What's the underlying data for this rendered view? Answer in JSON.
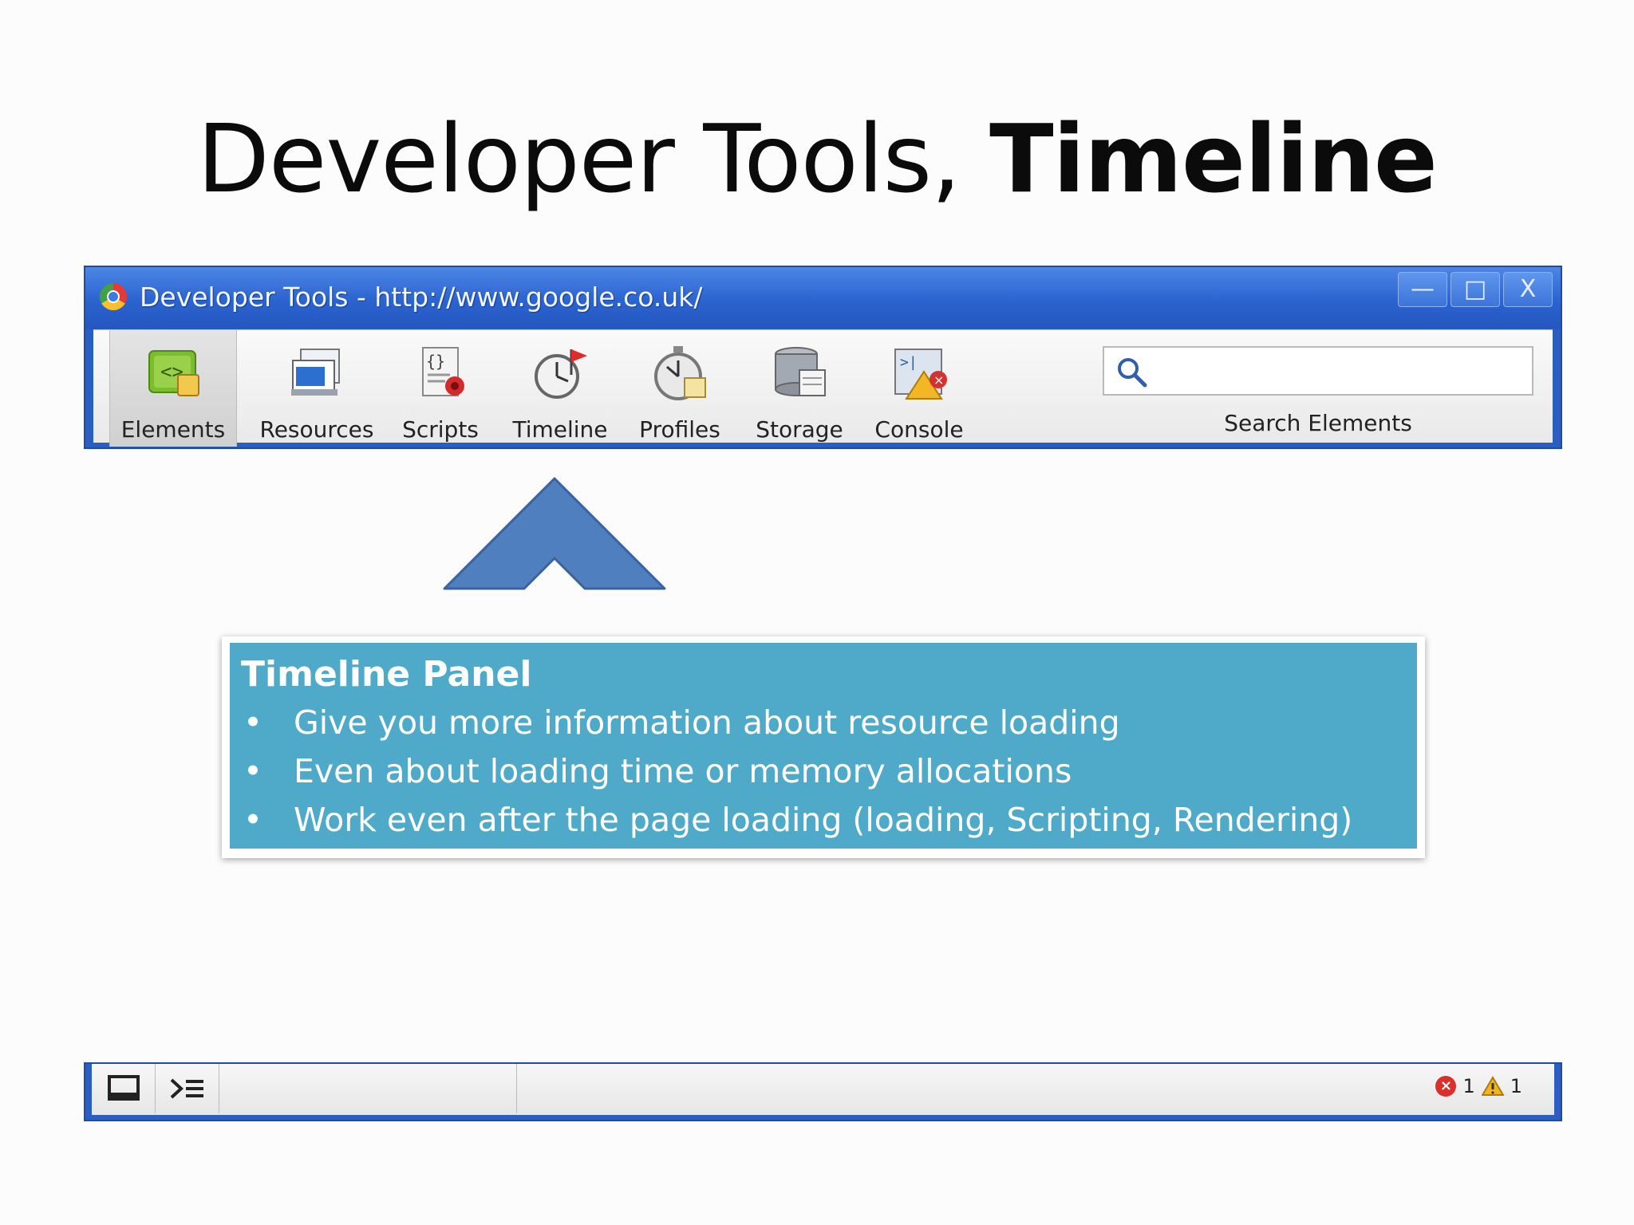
{
  "slide": {
    "title_regular": "Developer Tools, ",
    "title_bold": "Timeline"
  },
  "window": {
    "title": "Developer Tools - http://www.google.co.uk/",
    "controls": {
      "minimize": "—",
      "maximize": "□",
      "close": "X"
    }
  },
  "toolbar": {
    "items": [
      {
        "label": "Elements",
        "icon": "elements-icon"
      },
      {
        "label": "Resources",
        "icon": "resources-icon"
      },
      {
        "label": "Scripts",
        "icon": "scripts-icon"
      },
      {
        "label": "Timeline",
        "icon": "timeline-icon"
      },
      {
        "label": "Profiles",
        "icon": "profiles-icon"
      },
      {
        "label": "Storage",
        "icon": "storage-icon"
      },
      {
        "label": "Console",
        "icon": "console-icon"
      }
    ],
    "selected": "Elements",
    "search": {
      "value": "",
      "label": "Search Elements"
    }
  },
  "callout": {
    "title": "Timeline Panel",
    "bullet": "•",
    "items": [
      "Give you more information about resource loading",
      "Even about loading time or memory allocations",
      "Work even after the page loading (loading, Scripting, Rendering)"
    ],
    "color": "#4eaac8"
  },
  "statusbar": {
    "error_count": "1",
    "warning_count": "1",
    "error_glyph": "×"
  },
  "colors": {
    "window_frame": "#2a5fc2",
    "arrow_fill": "#4f7fbe"
  }
}
